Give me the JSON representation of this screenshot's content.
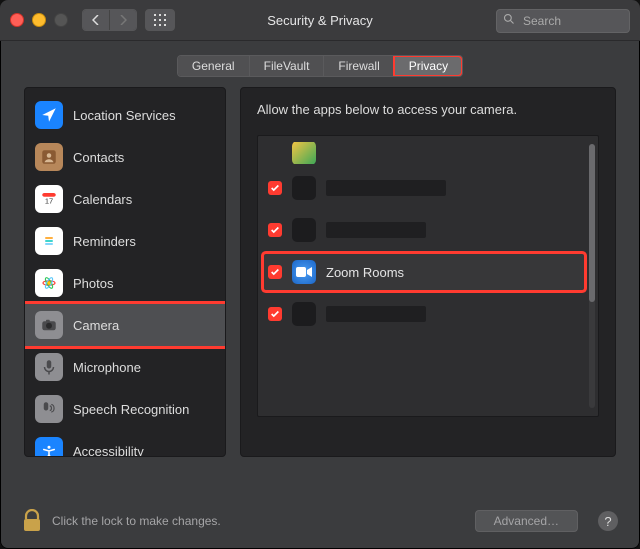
{
  "window": {
    "title": "Security & Privacy"
  },
  "search": {
    "placeholder": "Search"
  },
  "tabs": [
    {
      "label": "General",
      "active": false
    },
    {
      "label": "FileVault",
      "active": false
    },
    {
      "label": "Firewall",
      "active": false
    },
    {
      "label": "Privacy",
      "active": true
    }
  ],
  "sidebar": {
    "items": [
      {
        "label": "Location Services",
        "icon": "location-arrow",
        "bg": "#1a84ff",
        "selected": false
      },
      {
        "label": "Contacts",
        "icon": "contacts",
        "bg": "#b7875a",
        "selected": false
      },
      {
        "label": "Calendars",
        "icon": "calendar",
        "bg": "#ffffff",
        "selected": false
      },
      {
        "label": "Reminders",
        "icon": "reminders",
        "bg": "#ffffff",
        "selected": false
      },
      {
        "label": "Photos",
        "icon": "photos",
        "bg": "#ffffff",
        "selected": false
      },
      {
        "label": "Camera",
        "icon": "camera",
        "bg": "#8e8e92",
        "selected": true,
        "highlight": true
      },
      {
        "label": "Microphone",
        "icon": "microphone",
        "bg": "#8e8e92",
        "selected": false
      },
      {
        "label": "Speech Recognition",
        "icon": "speech",
        "bg": "#8e8e92",
        "selected": false
      },
      {
        "label": "Accessibility",
        "icon": "accessibility",
        "bg": "#1a84ff",
        "selected": false
      }
    ]
  },
  "right": {
    "heading": "Allow the apps below to access your camera.",
    "apps": [
      {
        "checked": true,
        "name": "",
        "highlight": false,
        "redacted": true,
        "icon": null
      },
      {
        "checked": true,
        "name": "",
        "highlight": false,
        "redacted": true,
        "icon": null
      },
      {
        "checked": true,
        "name": "Zoom Rooms",
        "highlight": true,
        "redacted": false,
        "icon": "zoom"
      },
      {
        "checked": true,
        "name": "",
        "highlight": false,
        "redacted": true,
        "icon": null
      }
    ]
  },
  "footer": {
    "lock_text": "Click the lock to make changes.",
    "advanced": "Advanced…"
  },
  "colors": {
    "highlight": "#ff3b30"
  }
}
